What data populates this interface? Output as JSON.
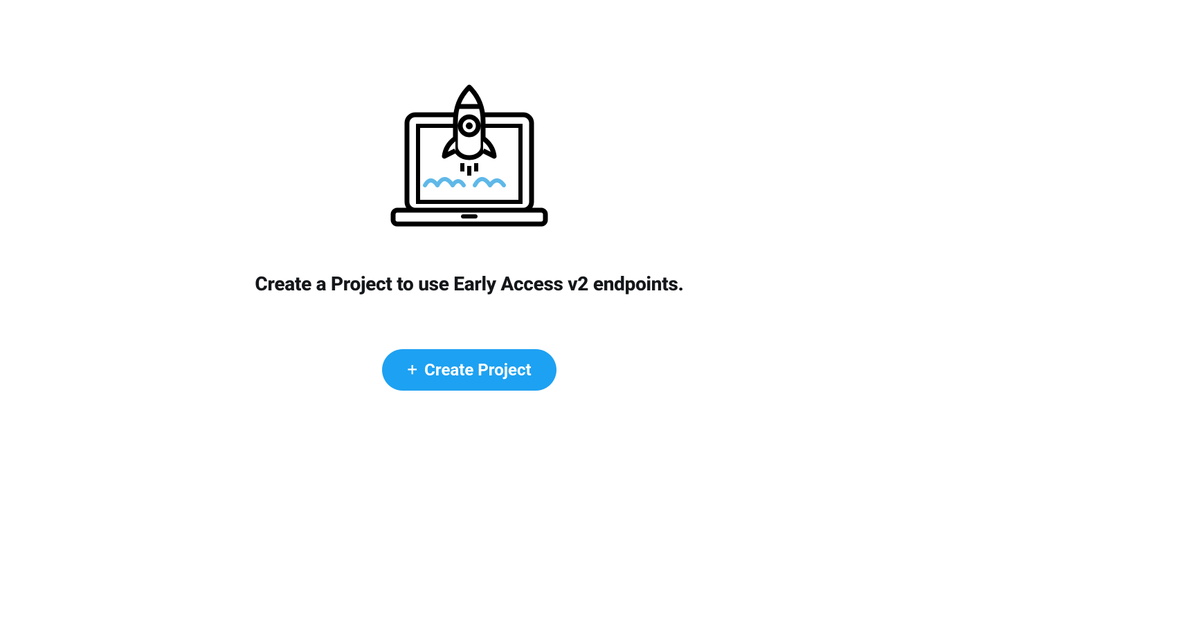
{
  "main": {
    "heading": "Create a Project to use Early Access v2 endpoints.",
    "button_label": "Create Project"
  },
  "colors": {
    "accent": "#1da1f2",
    "cloud": "#5fb8e8",
    "text": "#14171a"
  }
}
